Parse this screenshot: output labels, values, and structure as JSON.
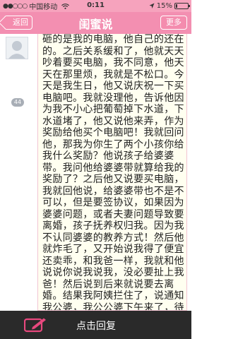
{
  "status_bar": {
    "carrier": "中国移动",
    "time": "0:11",
    "battery": "15%",
    "battery_level": 0.15
  },
  "nav": {
    "back_label": "返回",
    "title": "闺蜜说",
    "more_label": "更多"
  },
  "post": {
    "reply_count": "44",
    "text": "砸的是我的电脑，他自己的还在的。之后关系缓和了，他就天天吵着要买电脑，我不同意，他天天在那里烦，我就是不松口。今天是我生日，他又说庆祝一下买电脑吧。我就没理他，告诉他因为我不小心把葡萄掉下水道，下水道堵了，他又说他来弄，作为奖励给他买个电脑吧！我就回问他，那我为你生了两个小孩你给我什么奖励？他说孩子给婆婆带。我问他给婆婆带就算给我的奖励了？之后他又说要买电脑，我就回他说，给婆婆带也不是不可以，但是要签协议，如果因为婆婆问题，或者夫妻问题导致要离婚，孩子抚养权归我。因为我不认同婆婆的教养方式！然后他就炸毛了，又开始说我得了便宜还卖乖，和我爸一样，我就和他说说你说我说我，没必要扯上我爸！然后说到后来就说要去离婚。结果我阿姨拦住了，说通知我公婆，我公公婆下午来了，待了一下午。之后公婆走了，我问"
  },
  "bottom": {
    "reply_label": "点击回复"
  }
}
